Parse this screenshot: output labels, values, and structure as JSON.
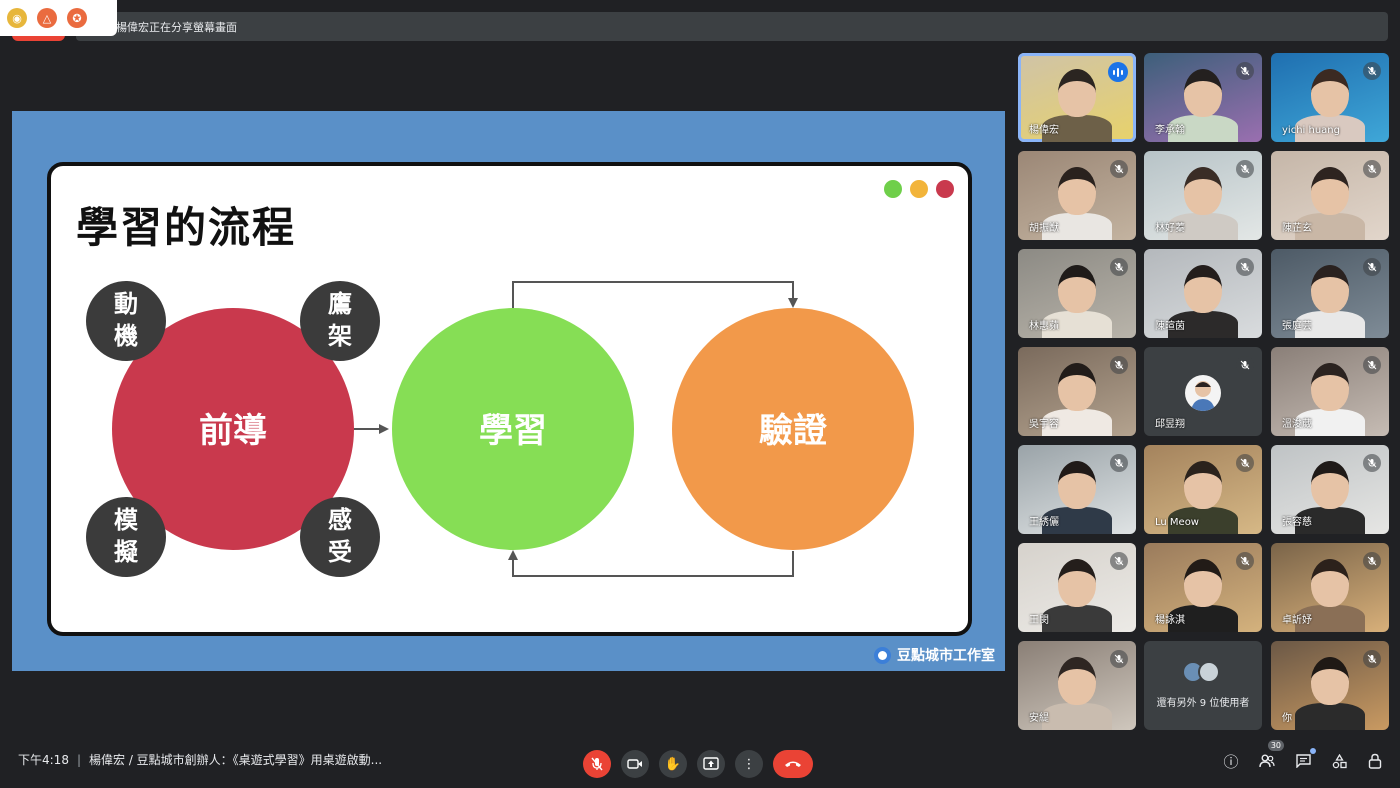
{
  "share_banner": {
    "text": "楊偉宏正在分享螢幕畫面"
  },
  "extension_icons": [
    "bell-icon",
    "drive-icon",
    "star-icon"
  ],
  "slide": {
    "title": "學習的流程",
    "window_dots": [
      "#6fcf4a",
      "#f2b43a",
      "#c9394d"
    ],
    "big_circles": [
      {
        "label": "前導",
        "color": "#c9394d"
      },
      {
        "label": "學習",
        "color": "#86de55"
      },
      {
        "label": "驗證",
        "color": "#f2994a"
      }
    ],
    "small_circles": [
      {
        "label": "動機"
      },
      {
        "label": "鷹架"
      },
      {
        "label": "模擬"
      },
      {
        "label": "感受"
      }
    ],
    "watermark": "豆點城市工作室"
  },
  "participants": [
    {
      "name": "楊偉宏",
      "speaking": true
    },
    {
      "name": "李承翰",
      "muted": true
    },
    {
      "name": "yichi huang",
      "muted": true
    },
    {
      "name": "胡振猷",
      "muted": true
    },
    {
      "name": "林好蓁",
      "muted": true
    },
    {
      "name": "陳芷玄",
      "muted": true
    },
    {
      "name": "林惠蘋",
      "muted": true
    },
    {
      "name": "陳暄茵",
      "muted": true
    },
    {
      "name": "張庭芸",
      "muted": true
    },
    {
      "name": "吳宇容",
      "muted": true
    },
    {
      "name": "邱昱翔",
      "muted": true
    },
    {
      "name": "溫浚葳",
      "muted": true
    },
    {
      "name": "王綉儷",
      "muted": true
    },
    {
      "name": "Lu Meow",
      "muted": true
    },
    {
      "name": "張容慈",
      "muted": true
    },
    {
      "name": "王閔",
      "muted": true
    },
    {
      "name": "楊詠淇",
      "muted": true
    },
    {
      "name": "卓訢妤",
      "muted": true
    },
    {
      "name": "安緹",
      "muted": true
    },
    {
      "name": "還有另外 9 位使用者"
    },
    {
      "name": "你",
      "muted": true
    }
  ],
  "bottom_bar": {
    "time": "下午4:18",
    "separator": "|",
    "meeting_title": "楊偉宏 / 豆點城市創辦人：《桌遊式學習》用桌遊啟動...",
    "controls": [
      "mic-off-icon",
      "camera-icon",
      "raise-hand-icon",
      "present-icon",
      "more-options-icon",
      "end-call-icon"
    ],
    "participant_count": "30"
  }
}
